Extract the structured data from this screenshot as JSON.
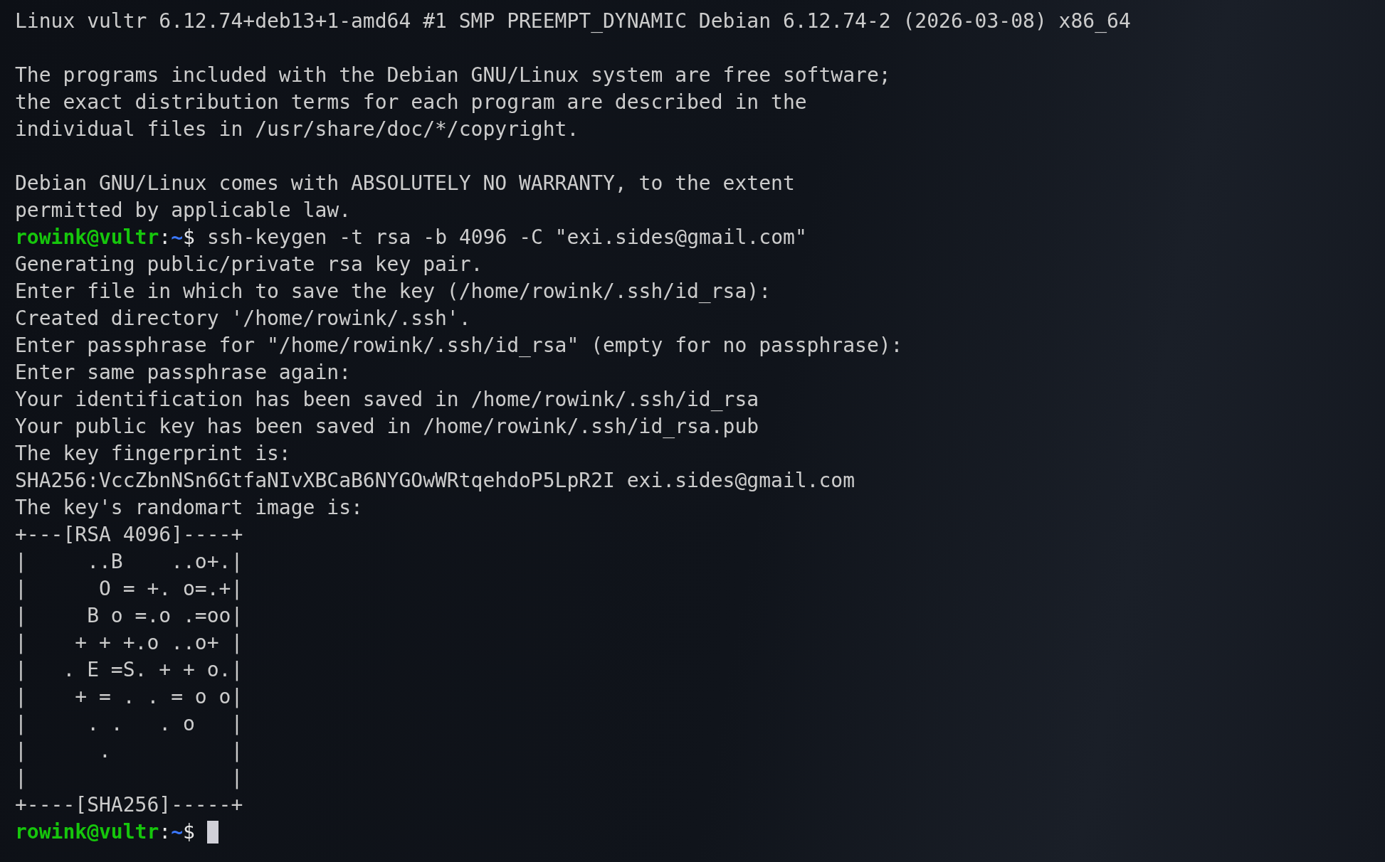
{
  "terminal": {
    "lines": [
      {
        "kind": "output",
        "text": "Linux vultr 6.12.74+deb13+1-amd64 #1 SMP PREEMPT_DYNAMIC Debian 6.12.74-2 (2026-03-08) x86_64"
      },
      {
        "kind": "blank"
      },
      {
        "kind": "output",
        "text": "The programs included with the Debian GNU/Linux system are free software;"
      },
      {
        "kind": "output",
        "text": "the exact distribution terms for each program are described in the"
      },
      {
        "kind": "output",
        "text": "individual files in /usr/share/doc/*/copyright."
      },
      {
        "kind": "blank"
      },
      {
        "kind": "output",
        "text": "Debian GNU/Linux comes with ABSOLUTELY NO WARRANTY, to the extent"
      },
      {
        "kind": "output",
        "text": "permitted by applicable law."
      },
      {
        "kind": "prompt",
        "user": "rowink@vultr",
        "separator": ":",
        "path": "~",
        "symbol": "$",
        "command": "ssh-keygen -t rsa -b 4096 -C \"exi.sides@gmail.com\"",
        "cursor": false
      },
      {
        "kind": "output",
        "text": "Generating public/private rsa key pair."
      },
      {
        "kind": "output",
        "text": "Enter file in which to save the key (/home/rowink/.ssh/id_rsa):"
      },
      {
        "kind": "output",
        "text": "Created directory '/home/rowink/.ssh'."
      },
      {
        "kind": "output",
        "text": "Enter passphrase for \"/home/rowink/.ssh/id_rsa\" (empty for no passphrase):"
      },
      {
        "kind": "output",
        "text": "Enter same passphrase again:"
      },
      {
        "kind": "output",
        "text": "Your identification has been saved in /home/rowink/.ssh/id_rsa"
      },
      {
        "kind": "output",
        "text": "Your public key has been saved in /home/rowink/.ssh/id_rsa.pub"
      },
      {
        "kind": "output",
        "text": "The key fingerprint is:"
      },
      {
        "kind": "output",
        "text": "SHA256:VccZbnNSn6GtfaNIvXBCaB6NYGOwWRtqehdoP5LpR2I exi.sides@gmail.com"
      },
      {
        "kind": "output",
        "text": "The key's randomart image is:"
      },
      {
        "kind": "output",
        "text": "+---[RSA 4096]----+"
      },
      {
        "kind": "output",
        "text": "|     ..B    ..o+.|"
      },
      {
        "kind": "output",
        "text": "|      O = +. o=.+|"
      },
      {
        "kind": "output",
        "text": "|     B o =.o .=oo|"
      },
      {
        "kind": "output",
        "text": "|    + + +.o ..o+ |"
      },
      {
        "kind": "output",
        "text": "|   . E =S. + + o.|"
      },
      {
        "kind": "output",
        "text": "|    + = . . = o o|"
      },
      {
        "kind": "output",
        "text": "|     . .   . o   |"
      },
      {
        "kind": "output",
        "text": "|      .          |"
      },
      {
        "kind": "output",
        "text": "|                 |"
      },
      {
        "kind": "output",
        "text": "+----[SHA256]-----+"
      },
      {
        "kind": "prompt",
        "user": "rowink@vultr",
        "separator": ":",
        "path": "~",
        "symbol": "$",
        "cursor": true
      }
    ]
  }
}
